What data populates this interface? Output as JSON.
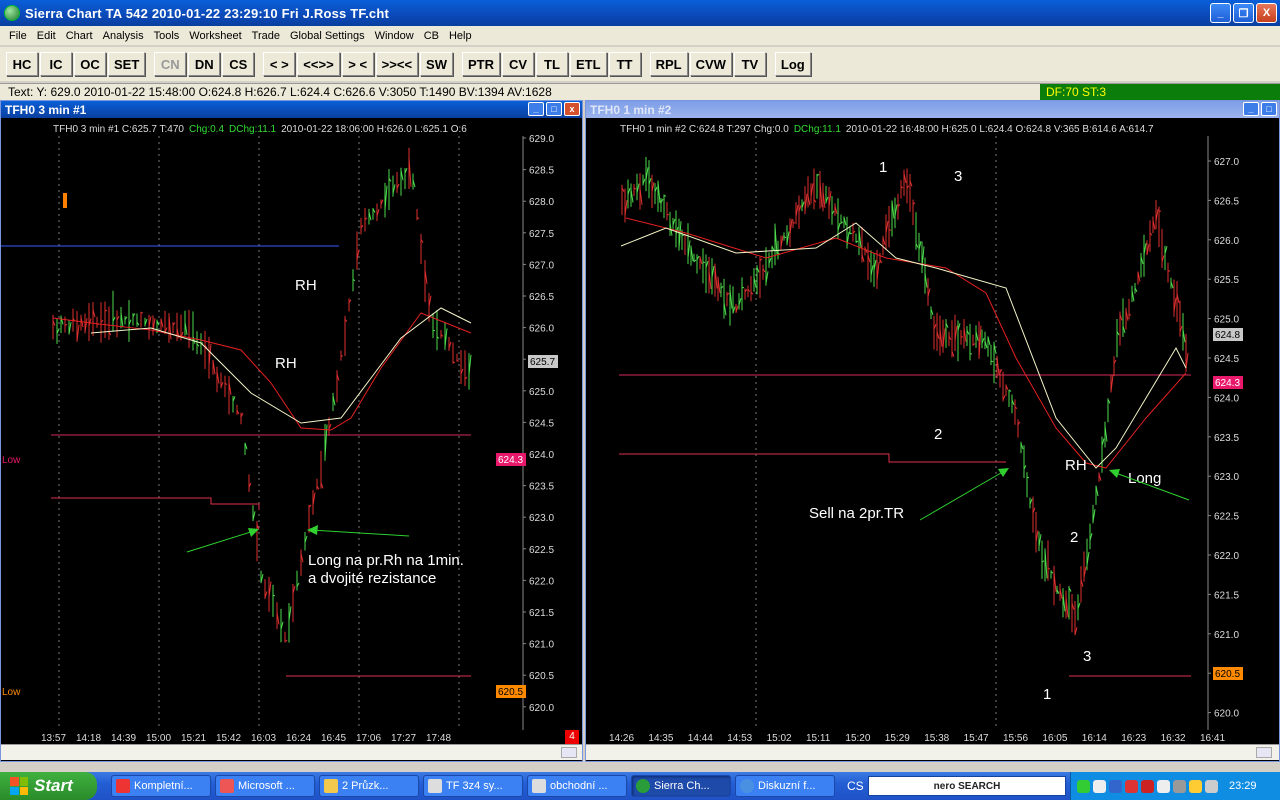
{
  "window": {
    "title": "Sierra Chart TA 542  2010-01-22  23:29:10  Fri   J.Ross TF.cht",
    "btn_min": "_",
    "btn_max": "❐",
    "btn_close": "X"
  },
  "menu": [
    "File",
    "Edit",
    "Chart",
    "Analysis",
    "Tools",
    "Worksheet",
    "Trade",
    "Global Settings",
    "Window",
    "CB",
    "Help"
  ],
  "toolbar": [
    "HC",
    "IC",
    "OC",
    "SET",
    "CN",
    "DN",
    "CS",
    "< >",
    "<<>>",
    "> <",
    ">><<",
    "SW",
    "PTR",
    "CV",
    "TL",
    "ETL",
    "TT",
    "RPL",
    "CVW",
    "TV",
    "Log"
  ],
  "status": {
    "text": "Text: Y: 629.0  2010-01-22  15:48:00  O:624.8  H:626.7  L:624.4  C:626.6  V:3050  T:1490  BV:1394  AV:1628",
    "df": "DF:70   ST:3"
  },
  "chart1": {
    "window_title": "TFH0  3 min   #1",
    "header_prefix": "TFH0  3 min   #1  C:625.7  T:470",
    "header_chg": "Chg:0.4",
    "header_dchg": "DChg:11.1",
    "header_suffix": "2010-01-22  18:06:00  H:626.0  L:625.1  O:6",
    "y_ticks": [
      "629.0",
      "628.5",
      "628.0",
      "627.5",
      "627.0",
      "626.5",
      "626.0",
      "625.5",
      "625.0",
      "624.5",
      "624.0",
      "623.5",
      "623.0",
      "622.5",
      "622.0",
      "621.5",
      "621.0",
      "620.5",
      "620.0"
    ],
    "x_ticks": [
      "13:57",
      "14:18",
      "14:39",
      "15:00",
      "15:21",
      "15:42",
      "16:03",
      "16:24",
      "16:45",
      "17:06",
      "17:27",
      "17:48"
    ],
    "price_label": "625.7",
    "marker_pink": "624.3",
    "marker_orange": "620.5",
    "low1": "Low",
    "low2": "Low",
    "annot_rh1": "RH",
    "annot_rh2": "RH",
    "annot_long1": "Long na pr.Rh na 1min.",
    "annot_long2": "a dvojité rezistance",
    "corner_badge": "4"
  },
  "chart2": {
    "window_title": "TFH0  1 min   #2",
    "header_prefix": "TFH0  1 min   #2  C:624.8  T:297  Chg:0.0",
    "header_dchg": "DChg:11.1",
    "header_suffix": "2010-01-22  16:48:00  H:625.0  L:624.4  O:624.8  V:365  B:614.6  A:614.7",
    "y_ticks": [
      "627.0",
      "626.5",
      "626.0",
      "625.5",
      "625.0",
      "624.5",
      "624.0",
      "623.5",
      "623.0",
      "622.5",
      "622.0",
      "621.5",
      "621.0",
      "620.5",
      "620.0"
    ],
    "x_ticks": [
      "14:26",
      "14:35",
      "14:44",
      "14:53",
      "15:02",
      "15:11",
      "15:20",
      "15:29",
      "15:38",
      "15:47",
      "15:56",
      "16:05",
      "16:14",
      "16:23",
      "16:32",
      "16:41"
    ],
    "price_label": "624.8",
    "marker_pink": "624.3",
    "marker_orange": "620.5",
    "annot_1a": "1",
    "annot_3a": "3",
    "annot_2a": "2",
    "annot_rh": "RH",
    "annot_long": "Long",
    "annot_sell": "Sell na 2pr.TR",
    "annot_2b": "2",
    "annot_3b": "3",
    "annot_1b": "1"
  },
  "taskbar": {
    "start": "Start",
    "tasks": [
      "Kompletní...",
      "Microsoft ...",
      "2 Průzk...",
      "TF 3z4 sy...",
      "obchodní ...",
      "Sierra Ch...",
      "Diskuzní f..."
    ],
    "cs": "CS",
    "search": "nero SEARCH",
    "clock": "23:29"
  }
}
